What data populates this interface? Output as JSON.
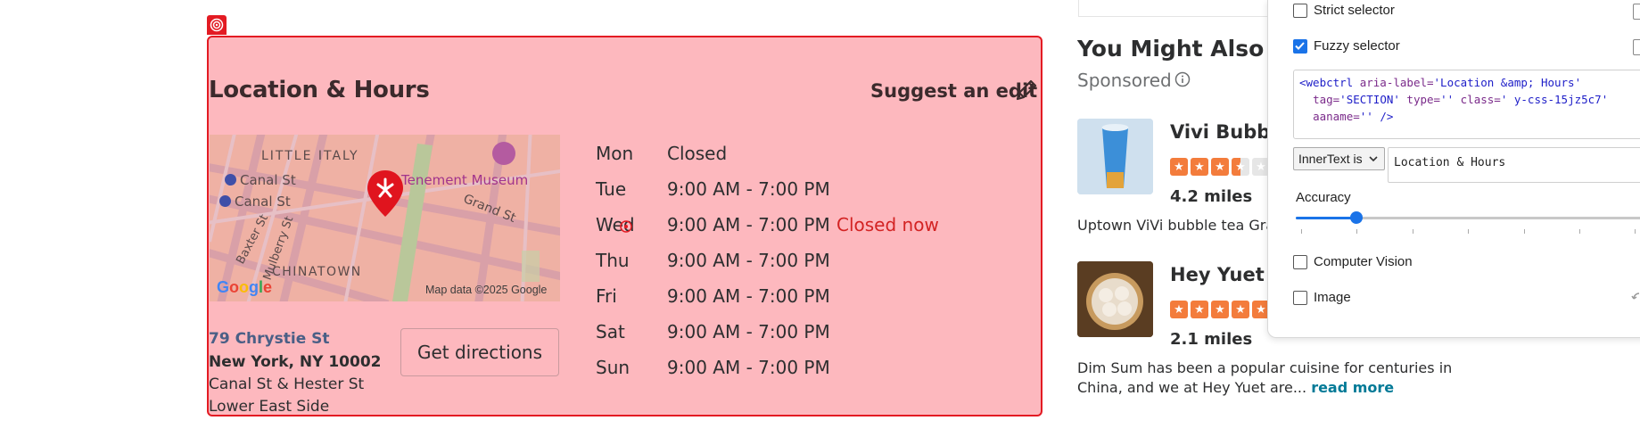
{
  "section": {
    "title": "Location & Hours",
    "suggest_edit": "Suggest an edit",
    "map": {
      "labels": [
        "LITTLE ITALY",
        "Canal St",
        "Canal St",
        "Tenement Museum",
        "Grand St",
        "Baxter St",
        "Mulberry St",
        "CHINATOWN"
      ],
      "attribution": "Map data ©2025 Google",
      "google_logo": "Google"
    },
    "address": {
      "street": "79 Chrystie St",
      "city": "New York, NY 10002",
      "cross": "Canal St & Hester St",
      "neighborhood": "Lower East Side"
    },
    "directions_label": "Get directions",
    "hours": [
      {
        "day": "Mon",
        "time": "Closed",
        "note": ""
      },
      {
        "day": "Tue",
        "time": "9:00 AM - 7:00 PM",
        "note": ""
      },
      {
        "day": "Wed",
        "time": "9:00 AM - 7:00 PM",
        "note": "Closed now"
      },
      {
        "day": "Thu",
        "time": "9:00 AM - 7:00 PM",
        "note": ""
      },
      {
        "day": "Fri",
        "time": "9:00 AM - 7:00 PM",
        "note": ""
      },
      {
        "day": "Sat",
        "time": "9:00 AM - 7:00 PM",
        "note": ""
      },
      {
        "day": "Sun",
        "time": "9:00 AM - 7:00 PM",
        "note": ""
      }
    ]
  },
  "sidebar": {
    "title": "You Might Also Co",
    "sponsored": "Sponsored",
    "businesses": [
      {
        "name": "Vivi Bubble",
        "miles": "4.2 miles",
        "rating": 3.5,
        "description": "Uptown ViVi bubble tea Grand"
      },
      {
        "name": "Hey Yuet",
        "miles": "2.1 miles",
        "rating": 5,
        "description": "Dim Sum has been a popular cuisine for centuries in China, and we at Hey Yuet are...",
        "read_more": "read more"
      }
    ]
  },
  "panel": {
    "strict_label": "Strict selector",
    "strict_checked": false,
    "fuzzy_label": "Fuzzy selector",
    "fuzzy_checked": true,
    "code": {
      "line1_tag": "<webctrl ",
      "line1_attr": "aria-label=",
      "line1_val": "'Location &amp; Hours'",
      "line2_attr1": "tag=",
      "line2_val1": "'SECTION'",
      "line2_attr2": " type=",
      "line2_val2": "''",
      "line2_attr3": " class=",
      "line2_val3": "' y-css-15jz5c7'",
      "line3_attr": "aaname=",
      "line3_val": "''",
      "line3_end": " />"
    },
    "select_value": "InnerText is",
    "inner_value": "Location & Hours",
    "accuracy_label": "Accuracy",
    "accuracy_value": 0.17,
    "cv_label": "Computer Vision",
    "cv_checked": false,
    "image_label": "Image",
    "image_checked": false
  },
  "colors": {
    "highlight_border": "#e31b23",
    "highlight_fill": "#fdb8be",
    "star_orange": "#f37c3c",
    "link_teal": "#027a97",
    "check_blue": "#1a73e8"
  }
}
